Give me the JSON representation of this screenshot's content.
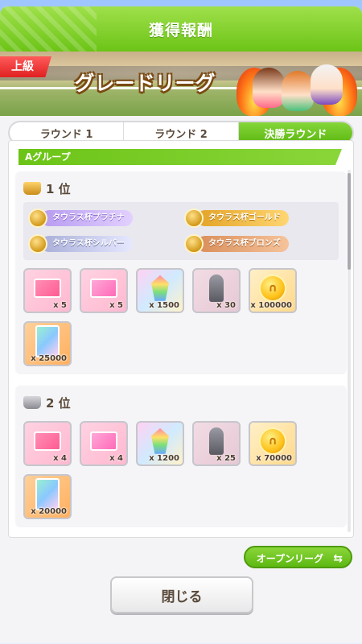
{
  "header": {
    "title": "獲得報酬"
  },
  "banner": {
    "rank_badge": "上級",
    "league_name": "グレードリーグ"
  },
  "tabs": [
    {
      "label": "ラウンド 1",
      "active": false
    },
    {
      "label": "ラウンド 2",
      "active": false
    },
    {
      "label": "決勝ラウンド",
      "active": true
    }
  ],
  "group": {
    "label": "Aグループ"
  },
  "places": [
    {
      "label": "1 位",
      "titles": [
        {
          "label": "タウラス杯プラチナ",
          "tier": "platinum"
        },
        {
          "label": "タウラス杯ゴールド",
          "tier": "gold"
        },
        {
          "label": "タウラス杯シルバー",
          "tier": "silver"
        },
        {
          "label": "タウラス杯ブロンズ",
          "tier": "bronze"
        }
      ],
      "items": [
        {
          "icon": "ticket-icon",
          "qty": "x 5"
        },
        {
          "icon": "ticket-icon",
          "qty": "x 5"
        },
        {
          "icon": "crystal-icon",
          "qty": "x 1500"
        },
        {
          "icon": "statue-icon",
          "qty": "x 30"
        },
        {
          "icon": "coin-icon",
          "qty": "x 100000"
        },
        {
          "icon": "card-icon",
          "qty": "x 25000"
        }
      ]
    },
    {
      "label": "2 位",
      "items": [
        {
          "icon": "ticket-icon",
          "qty": "x 4"
        },
        {
          "icon": "ticket-icon",
          "qty": "x 4"
        },
        {
          "icon": "crystal-icon",
          "qty": "x 1200"
        },
        {
          "icon": "statue-icon",
          "qty": "x 25"
        },
        {
          "icon": "coin-icon",
          "qty": "x 70000"
        },
        {
          "icon": "card-icon",
          "qty": "x 20000"
        }
      ]
    }
  ],
  "buttons": {
    "open_league": "オープンリーグ",
    "close": "閉じる"
  }
}
